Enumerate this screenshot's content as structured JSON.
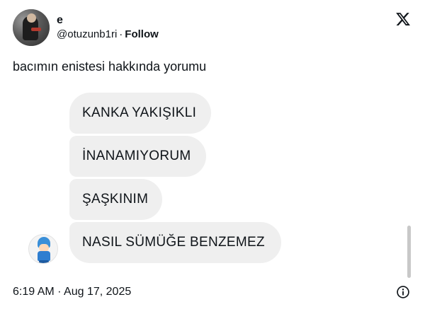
{
  "author": {
    "display_name": "e",
    "handle": "@otuzunb1ri",
    "separator": "·",
    "follow_label": "Follow"
  },
  "tweet": {
    "text": "bacımın enistesi hakkında yorumu",
    "timestamp": "6:19 AM · Aug 17, 2025"
  },
  "messages": [
    "KANKA YAKIŞIKLI",
    "İNANAMIYORUM",
    "ŞAŞKINIM",
    "NASIL SÜMÜĞE BENZEMEZ"
  ],
  "icons": {
    "brand": "x-logo-icon",
    "info": "info-icon"
  },
  "colors": {
    "text": "#0f1419",
    "bubble": "#efefef",
    "scrollbar": "#c8c8c8"
  }
}
